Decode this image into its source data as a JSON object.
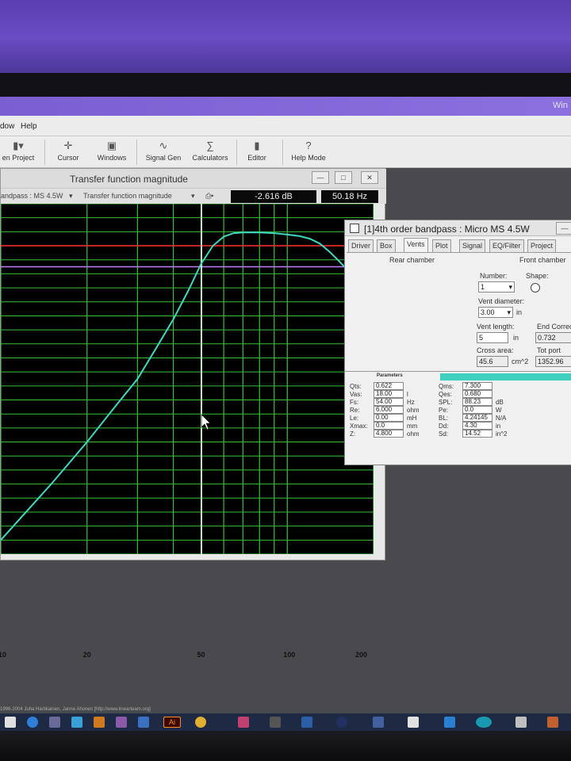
{
  "os": {
    "title_fragment": "Win"
  },
  "menu": [
    "dow",
    "Help"
  ],
  "toolbar": [
    {
      "label": "en Project",
      "icon": "folder-icon"
    },
    {
      "label": "Cursor",
      "icon": "crosshair-icon"
    },
    {
      "label": "Windows",
      "icon": "windows-icon"
    },
    {
      "label": "Signal Gen",
      "icon": "wave-icon"
    },
    {
      "label": "Calculators",
      "icon": "calculator-icon"
    },
    {
      "label": "Editor",
      "icon": "editor-icon"
    },
    {
      "label": "Help Mode",
      "icon": "help-icon",
      "glyph": "?"
    }
  ],
  "graph": {
    "title": "Transfer function magnitude",
    "source": "andpass : MS 4.5W",
    "curve_select": "Transfer function magnitude",
    "readout_db": "-2.616 dB",
    "readout_hz": "50.18 Hz",
    "x_tick_labels": [
      "10",
      "20",
      "50",
      "100",
      "200"
    ]
  },
  "chart_data": {
    "type": "line",
    "xscale": "log",
    "xlim": [
      10,
      200
    ],
    "x_ticks": [
      10,
      20,
      50,
      100,
      200
    ],
    "grid": true,
    "cursor_x": 50.18,
    "series": [
      {
        "color": "#40d8c0",
        "x": [
          10,
          15,
          20,
          25,
          30,
          35,
          40,
          45,
          50,
          55,
          60,
          65,
          70,
          80,
          90,
          100,
          110,
          120,
          130,
          140,
          150,
          160,
          170,
          180,
          190,
          200
        ],
        "y": [
          -42,
          -34,
          -28,
          -23,
          -19,
          -14.5,
          -10.5,
          -6.5,
          -2.6,
          0,
          1.3,
          1.8,
          1.9,
          1.9,
          1.8,
          1.6,
          1.4,
          1.0,
          0.3,
          -0.8,
          -2.0,
          -3.2,
          -4.6,
          -6.0,
          -7.4,
          -8.8
        ]
      }
    ],
    "reference_lines": [
      {
        "color": "#ff3030",
        "y": 0
      },
      {
        "color": "#c080ff",
        "y": -3
      }
    ],
    "ylim": [
      -44,
      6
    ]
  },
  "dialog": {
    "title": "[1]4th order bandpass : Micro MS 4.5W",
    "tabs": [
      "Driver",
      "Box",
      "Vents",
      "Plot",
      "Signal",
      "EQ/Filter",
      "Project"
    ],
    "active_tab": "Vents",
    "rear_chamber": "Rear chamber",
    "front_chamber": "Front chamber",
    "number_label": "Number:",
    "number_value": "1",
    "shape_label": "Shape:",
    "vent_diameter_label": "Vent diameter:",
    "vent_diameter_value": "3.00",
    "vent_diameter_unit": "in",
    "vent_length_label": "Vent length:",
    "vent_length_value": "5",
    "vent_length_unit": "in",
    "end_correction_label": "End Correc",
    "end_correction_value": "0.732",
    "cross_area_label": "Cross area:",
    "cross_area_value": "45.6",
    "cross_area_unit": "cm^2",
    "tot_port_label": "Tot port resc",
    "tot_port_value": "1352.96",
    "params_header": "Parameters",
    "params_left": [
      {
        "name": "Qts:",
        "value": "0.622",
        "unit": ""
      },
      {
        "name": "Vas:",
        "value": "18.00",
        "unit": "l"
      },
      {
        "name": "Fs:",
        "value": "54.00",
        "unit": "Hz"
      },
      {
        "name": "Re:",
        "value": "6.000",
        "unit": "ohm"
      },
      {
        "name": "Le:",
        "value": "0.00",
        "unit": "mH"
      },
      {
        "name": "Xmax:",
        "value": "0.0",
        "unit": "mm"
      },
      {
        "name": "Z:",
        "value": "4.800",
        "unit": "ohm"
      }
    ],
    "params_right": [
      {
        "name": "Qms:",
        "value": "7.300",
        "unit": ""
      },
      {
        "name": "Qes:",
        "value": "0.680",
        "unit": ""
      },
      {
        "name": "SPL:",
        "value": "88.23",
        "unit": "dB"
      },
      {
        "name": "Pe:",
        "value": "0.0",
        "unit": "W"
      },
      {
        "name": "BL:",
        "value": "4.24145",
        "unit": "N/A"
      },
      {
        "name": "Dd:",
        "value": "4.30",
        "unit": "in"
      },
      {
        "name": "Sd:",
        "value": "14.52",
        "unit": "in^2"
      }
    ]
  },
  "credit": "1996-2004 Juha Hartikainen, Janne Ahonen [http://www.linearteam.org]"
}
